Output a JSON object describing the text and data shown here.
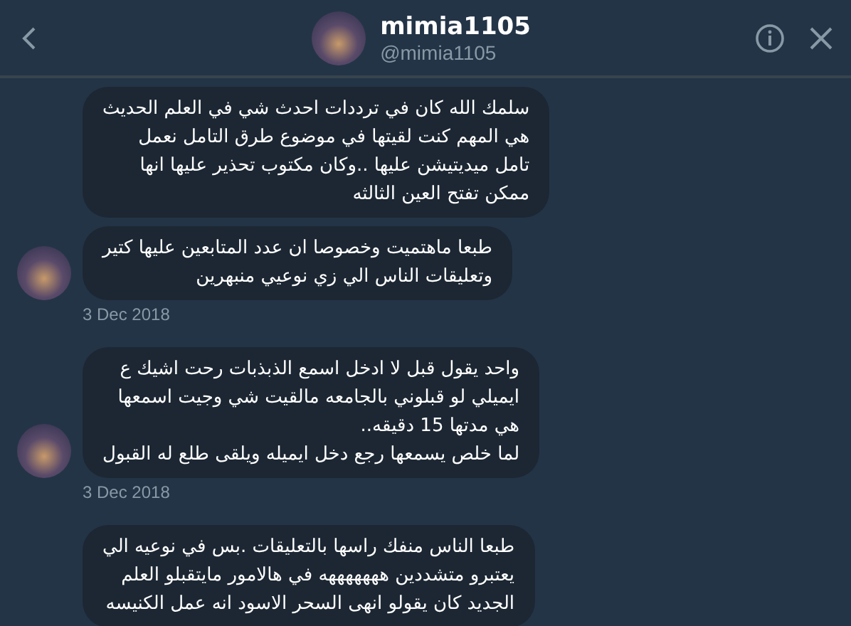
{
  "header": {
    "name": "mimia1105",
    "handle": "@mimia1105"
  },
  "messages": [
    {
      "text": "سلمك الله كان في ترددات احدث شي في العلم الحديث\nهي المهم كنت لقيتها في موضوع طرق التامل نعمل\nتامل ميديتيشن عليها ..وكان مكتوب تحذير عليها انها\nممكن تفتح العين الثالثه",
      "show_avatar": false
    },
    {
      "text": "طبعا ماهتميت وخصوصا ان عدد المتابعين عليها كتير\nوتعليقات الناس   الي زي نوعيي منبهرين",
      "show_avatar": true,
      "timestamp": "3 Dec 2018"
    },
    {
      "text": "واحد يقول قبل لا ادخل اسمع الذبذبات رحت اشيك ع\nايميلي لو قبلوني بالجامعه مالقيت شي وجيت اسمعها\nهي مدتها 15 دقيقه..\nلما خلص يسمعها رجع دخل ايميله ويلقى طلع له القبول",
      "show_avatar": true,
      "timestamp": "3 Dec 2018"
    },
    {
      "text": "طبعا الناس منفك راسها بالتعليقات .بس في نوعيه الي\nيعتبرو متشددين هههههههه في هالامور مايتقبلو العلم\nالجديد كان يقولو  انهى السحر الاسود انه عمل الكنيسه",
      "show_avatar": false
    }
  ]
}
